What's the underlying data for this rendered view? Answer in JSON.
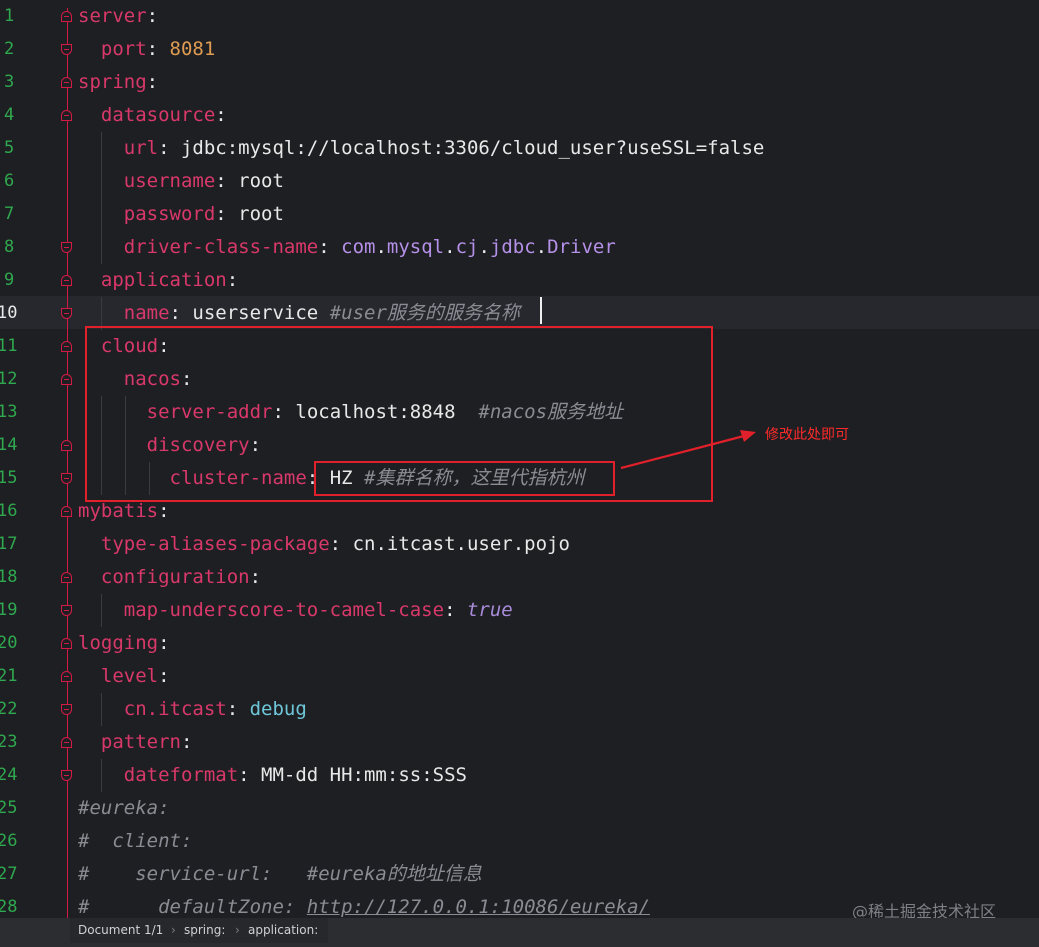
{
  "editor": {
    "line_numbers": [
      "1",
      "2",
      "3",
      "4",
      "5",
      "6",
      "7",
      "8",
      "9",
      "10",
      "11",
      "12",
      "13",
      "14",
      "15",
      "16",
      "17",
      "18",
      "19",
      "20",
      "21",
      "22",
      "23",
      "24",
      "25",
      "26",
      "27",
      "28"
    ],
    "current_line": "10",
    "code": {
      "l1_key": "server",
      "l2_key": "port",
      "l2_val": "8081",
      "l3_key": "spring",
      "l4_key": "datasource",
      "l5_key": "url",
      "l5_val": "jdbc:mysql://localhost:3306/cloud_user?useSSL=false",
      "l6_key": "username",
      "l6_val": "root",
      "l7_key": "password",
      "l7_val": "root",
      "l8_key": "driver-class-name",
      "l8_val_parts": [
        "com",
        "mysql",
        "cj",
        "jdbc",
        "Driver"
      ],
      "l9_key": "application",
      "l10_key": "name",
      "l10_val": "userservice",
      "l10_comment": "#user服务的服务名称",
      "l11_key": "cloud",
      "l12_key": "nacos",
      "l13_key": "server-addr",
      "l13_val": "localhost:8848",
      "l13_comment": "#nacos服务地址",
      "l14_key": "discovery",
      "l15_key": "cluster-name",
      "l15_val": "HZ",
      "l15_comment": "#集群名称，这里代指杭州",
      "l16_key": "mybatis",
      "l17_key": "type-aliases-package",
      "l17_val": "cn.itcast.user.pojo",
      "l18_key": "configuration",
      "l19_key": "map-underscore-to-camel-case",
      "l19_val": "true",
      "l20_key": "logging",
      "l21_key": "level",
      "l22_key": "cn.itcast",
      "l22_val": "debug",
      "l23_key": "pattern",
      "l24_key": "dateformat",
      "l24_val": "MM-dd HH:mm:ss:SSS",
      "l25_comment": "#eureka:",
      "l26_comment": "#  client:",
      "l27_comment": "#    service-url:   #eureka的地址信息",
      "l28_comment_prefix": "#      defaultZone: ",
      "l28_url": "http://127.0.0.1:10086/eureka/"
    }
  },
  "annotation": {
    "text": "修改此处即可",
    "color": "#e0202a"
  },
  "watermark": "@稀土掘金技术社区",
  "statusbar": {
    "document": "Document 1/1",
    "crumb1": "spring:",
    "crumb2": "application:",
    "separator": "›"
  },
  "colors": {
    "background": "#1e1f22",
    "key": "#d9386a",
    "number": "#e09b53",
    "comment": "#8a8c93",
    "boolean": "#a88bd9",
    "line_number": "#2fa84f"
  },
  "icons": {
    "fold_open": "fold-open-icon",
    "fold_close": "fold-close-icon"
  }
}
